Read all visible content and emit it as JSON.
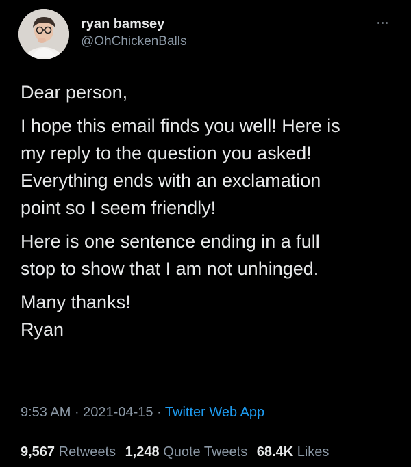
{
  "tweet": {
    "author": {
      "display_name": "ryan bamsey",
      "handle": "@OhChickenBalls"
    },
    "body": {
      "greeting": "Dear person,",
      "paragraph1": [
        "I hope this email finds you well! Here is",
        "my reply to the question you asked!",
        "Everything ends with an exclamation",
        "point so I seem friendly!"
      ],
      "paragraph2": [
        "Here is one sentence ending in a full",
        "stop to show that I am not unhinged."
      ],
      "signoff": "Many thanks!",
      "signature": "Ryan"
    },
    "meta": {
      "time": "9:53 AM",
      "separator": " · ",
      "date": "2021-04-15",
      "source": "Twitter Web App"
    },
    "stats": {
      "retweets_count": "9,567",
      "retweets_label": "Retweets",
      "quotes_count": "1,248",
      "quotes_label": "Quote Tweets",
      "likes_count": "68.4K",
      "likes_label": "Likes"
    }
  },
  "icons": {
    "more": "more-horizontal-icon"
  },
  "colors": {
    "background": "#000000",
    "primary_text": "#e7e9ea",
    "secondary_text": "#8b98a5",
    "link": "#1d9bf0",
    "divider": "#2f3336"
  }
}
